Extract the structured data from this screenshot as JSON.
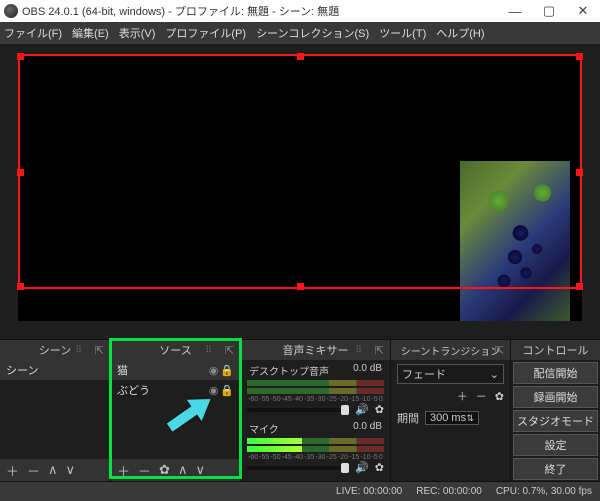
{
  "title": "OBS 24.0.1 (64-bit, windows) - プロファイル: 無題 - シーン: 無題",
  "menu": [
    "ファイル(F)",
    "編集(E)",
    "表示(V)",
    "プロファイル(P)",
    "シーンコレクション(S)",
    "ツール(T)",
    "ヘルプ(H)"
  ],
  "panels": {
    "scenes": {
      "title": "シーン",
      "items": [
        "シーン"
      ]
    },
    "sources": {
      "title": "ソース",
      "items": [
        "猫",
        "ぶどう"
      ]
    },
    "mixer": {
      "title": "音声ミキサー",
      "channels": [
        {
          "name": "デスクトップ音声",
          "db": "0.0 dB"
        },
        {
          "name": "マイク",
          "db": "0.0 dB"
        }
      ],
      "ticks": [
        "-60",
        "-55",
        "-50",
        "-45",
        "-40",
        "-35",
        "-30",
        "-25",
        "-20",
        "-15",
        "-10",
        "-5",
        "0"
      ]
    },
    "transition": {
      "title": "シーントランジション",
      "mode": "フェード",
      "durLabel": "期間",
      "durVal": "300 ms"
    },
    "controls": {
      "title": "コントロール",
      "buttons": [
        "配信開始",
        "録画開始",
        "スタジオモード",
        "設定",
        "終了"
      ]
    }
  },
  "status": {
    "live": "LIVE: 00:00:00",
    "rec": "REC: 00:00:00",
    "cpu": "CPU: 0.7%, 30.00 fps"
  },
  "sym": {
    "plus": "＋",
    "minus": "－",
    "gear": "✿",
    "up": "∧",
    "down": "∨",
    "eye": "◉",
    "lock": "🔒",
    "spk": "🔊",
    "updn": "⇅",
    "pop": "⇱",
    "chev": "⌄"
  }
}
